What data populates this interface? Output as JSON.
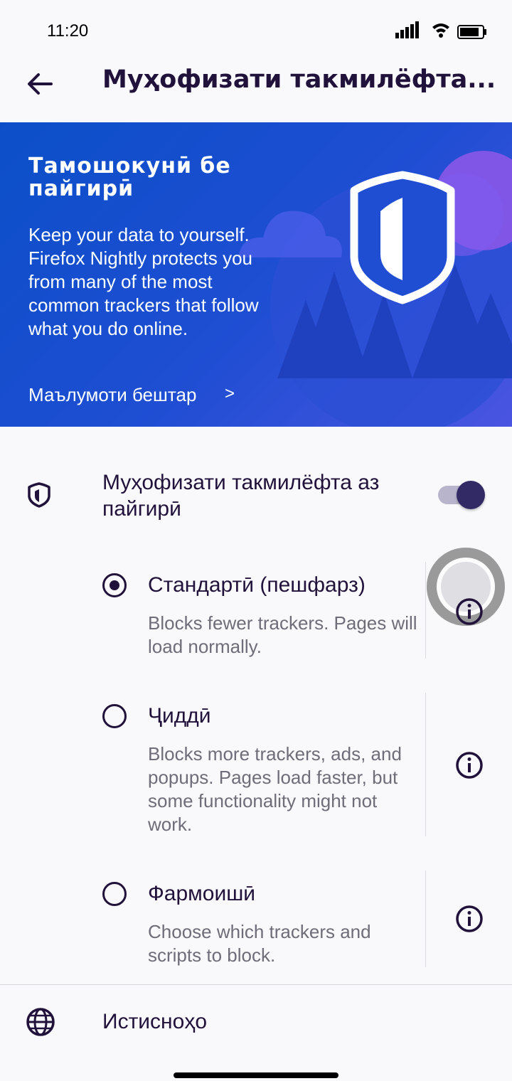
{
  "status_bar": {
    "time": "11:20"
  },
  "app_bar": {
    "title": "Муҳофизати такмилёфта..."
  },
  "banner": {
    "title": "Тамошокунӣ бе пайгирӣ",
    "text": "Keep your data to yourself. Firefox Nightly protects you from many of the most common trackers that follow what you do online.",
    "link_label": "Маълумоти бештар",
    "link_chevron": ">"
  },
  "etp": {
    "label": "Муҳофизати такмилёфта аз пайгирӣ",
    "enabled": true
  },
  "options": [
    {
      "label": "Стандартӣ (пешфарз)",
      "description": "Blocks fewer trackers. Pages will load normally.",
      "selected": true
    },
    {
      "label": "Ҷиддӣ",
      "description": "Blocks more trackers, ads, and popups. Pages load faster, but some functionality might not work.",
      "selected": false
    },
    {
      "label": "Фармоишӣ",
      "description": "Choose which trackers and scripts to block.",
      "selected": false
    }
  ],
  "exceptions": {
    "label": "Истисноҳо"
  },
  "colors": {
    "accent": "#312a65",
    "banner": "#1f4ed3",
    "text": "#20123a",
    "secondary_text": "#6e6d78"
  }
}
